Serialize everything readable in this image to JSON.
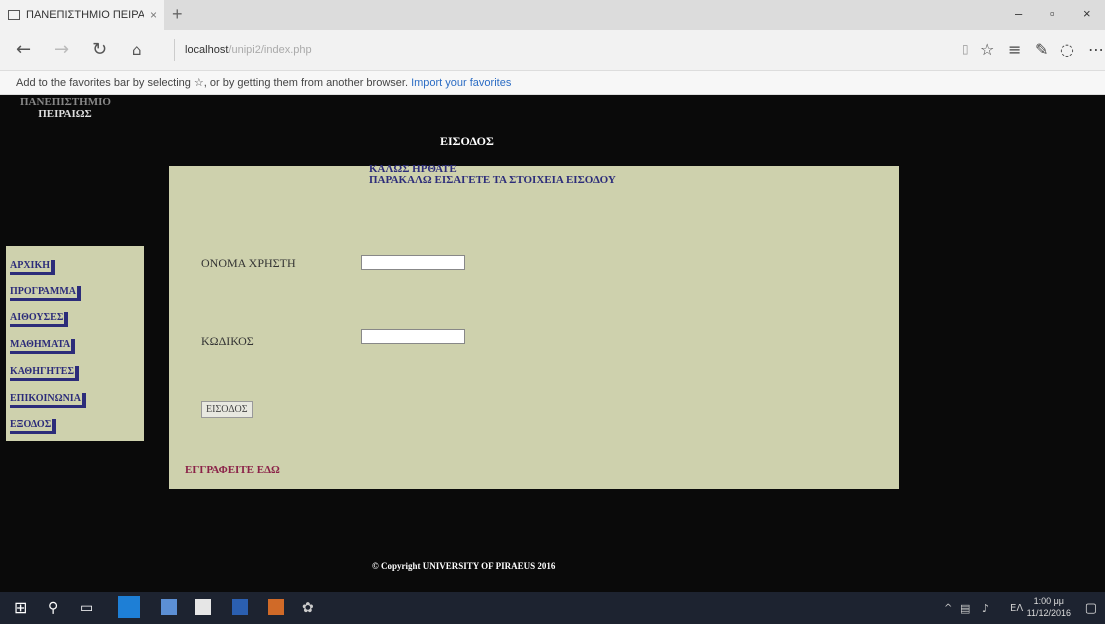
{
  "browser": {
    "tab_title": "ΠΑΝΕΠΙΣΤΗΜΙΟ ΠΕΙΡΑΙ",
    "tab_close": "×",
    "new_tab": "+",
    "url_host": "localhost",
    "url_path": "/unipi2/index.php",
    "favorites_msg": "Add to the favorites bar by selecting ☆, or by getting them from another browser. ",
    "import_link": "Import your favorites",
    "win_minimize": "–",
    "win_maximize": "▫",
    "win_close": "×"
  },
  "page": {
    "logo_line1": "ΠΑΝΕΠΙΣΤΗΜΙΟ",
    "logo_line2": "ΠΕΙΡΑΙΩΣ",
    "heading": "ΕΙΣΟΔΟΣ",
    "welcome1": "ΚΑΛΩΣ ΗΡΘΑΤΕ",
    "welcome2": "ΠΑΡΑΚΑΛΩ ΕΙΣΑΓΕΤΕ ΤΑ ΣΤΟΙΧΕΙΑ ΕΙΣΟΔΟΥ",
    "username_label": "ΟΝΟΜΑ ΧΡΗΣΤΗ",
    "password_label": "ΚΩΔΙΚΟΣ",
    "username_value": "",
    "password_value": "",
    "login_button": "ΕΙΣΟΔΟΣ",
    "register_link": "ΕΓΓΡΑΦΕΙΤΕ ΕΔΩ",
    "footer": "© Copyright UNIVERSITY OF PIRAEUS 2016"
  },
  "sidebar": {
    "items": [
      {
        "label": "ΑΡΧΙΚΗ"
      },
      {
        "label": "ΠΡΟΓΡΑΜΜΑ"
      },
      {
        "label": "ΑΙΘΟΥΣΕΣ"
      },
      {
        "label": "ΜΑΘΗΜΑΤΑ"
      },
      {
        "label": "ΚΑΘΗΓΗΤΕΣ"
      },
      {
        "label": "ΕΠΙΚΟΙΝΩΝΙΑ"
      },
      {
        "label": "ΕΞΟΔΟΣ"
      }
    ]
  },
  "taskbar": {
    "time": "1:00 μμ",
    "date": "11/12/2016",
    "lang": "ΕΛ"
  },
  "colors": {
    "page_bg": "#0a0a0a",
    "panel_bg": "#ced1ad",
    "menu_text": "#2c2c7a",
    "register_text": "#8b2248"
  }
}
